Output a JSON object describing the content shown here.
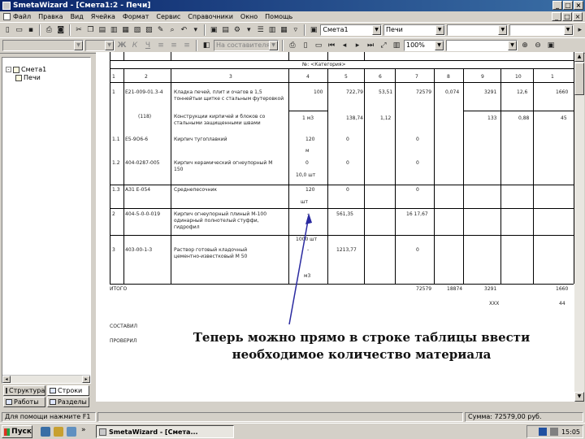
{
  "window": {
    "title": "SmetaWizard - [Смета1:2 - Печи]",
    "min": "_",
    "max": "□",
    "close": "×"
  },
  "menu": [
    "Файл",
    "Правка",
    "Вид",
    "Ячейка",
    "Формат",
    "Сервис",
    "Справочники",
    "Окно",
    "Помощь"
  ],
  "toolbar1": {
    "combo1": "Смета1",
    "combo2": "Печи"
  },
  "toolbar2": {
    "combo_style": "На составителя",
    "zoom": "100%"
  },
  "tree": {
    "root": "Смета1",
    "child": "Печи",
    "expand": "-"
  },
  "left_tabs": {
    "structure": "Структура",
    "rows": "Строки",
    "works": "Работы",
    "sections": "Разделы"
  },
  "table": {
    "header_label": "№: <Категория>",
    "col_nums": [
      "1",
      "2",
      "3",
      "4",
      "5",
      "6",
      "7",
      "8",
      "9",
      "10",
      "1"
    ],
    "rows": [
      {
        "n": "1",
        "code": "Е21-009-01.3-4",
        "name1": "Кладка печей, плит и очагов в 1,5",
        "name2": "тоннейтыи щитке с стальным футеровкой",
        "v4": "100",
        "v5": "722,79",
        "v6": "53,51",
        "v7": "72579",
        "v8": "0,074",
        "v9": "3291",
        "v10": "12,6",
        "v11": "1660"
      },
      {
        "n": "",
        "code": "(118)",
        "name1": "Конструкции кирпичей и блоков со",
        "name2": "стальными защищенными швами",
        "v4": "1 м3",
        "v5": "138,74",
        "v6": "1,12",
        "v7": "",
        "v8": "",
        "v9": "133",
        "v10": "0,88",
        "v11": "45"
      },
      {
        "n": "1.1",
        "code": "Е5-9О6-6",
        "name1": "Кирпич тугоплавкий",
        "name2": "",
        "v4": "120",
        "v5": "0",
        "v6": "",
        "v7": "0",
        "v8": "",
        "v9": "",
        "v10": "",
        "v11": ""
      },
      {
        "n": "1.2",
        "code": "404-0287-005",
        "name1": "Кирпич керамический огнеупорный М",
        "name2": "150",
        "v4": "0",
        "v5": "0",
        "v6": "",
        "v7": "0",
        "v8": "",
        "v9": "",
        "v10": "",
        "v11": ""
      },
      {
        "n": "1.3",
        "code": "АЗ1 Е-054",
        "name1": "Среднепесочник",
        "name2": "",
        "v4": "120",
        "v5": "0",
        "v6": "",
        "v7": "0",
        "v8": "",
        "v9": "",
        "v10": "",
        "v11": ""
      },
      {
        "n": "2",
        "code": "404-5-0-0-019",
        "name1": "Кирпич огнеупорный плиный М-100",
        "name2": "одинарный полнотелый стуффи,",
        "name3": "гидрофил",
        "v4": "-",
        "v5": "561,35",
        "v6": "",
        "v7": "16 17,67",
        "v8": "",
        "v9": "",
        "v10": "",
        "v11": ""
      },
      {
        "n": "3",
        "code": "403-00-1-3",
        "name1": "Раствор готовый кладочный",
        "name2": "цементно-известковый М 50",
        "v4": "-",
        "v5": "1213,77",
        "v6": "",
        "v7": "0",
        "v8": "",
        "v9": "",
        "v10": "",
        "v11": ""
      }
    ],
    "units": [
      "м",
      "10,0 шт",
      "т",
      "шт",
      "1000 шт",
      "м3"
    ],
    "total_label": "ИТОГО",
    "total_v7": "72579",
    "total_v8": "18874",
    "total_v9": "3291",
    "total_v11": "1660",
    "total_sub": "ХХХ",
    "total_sub2": "44",
    "composed": "СОСТАВИЛ",
    "checked": "ПРОВЕРИЛ"
  },
  "annotation": {
    "line1": "Теперь можно прямо в строке таблицы ввести",
    "line2": "необходимое количество материала"
  },
  "status": {
    "hint": "Для помощи нажмите F1",
    "sum": "Сумма: 72579,00 руб."
  },
  "taskbar": {
    "start": "Пуск",
    "task": "SmetaWizard - [Смета...",
    "chevron": "»",
    "clock": "15:05"
  },
  "colors": {
    "titlebar": "#0a246a",
    "face": "#d4d0c8"
  }
}
